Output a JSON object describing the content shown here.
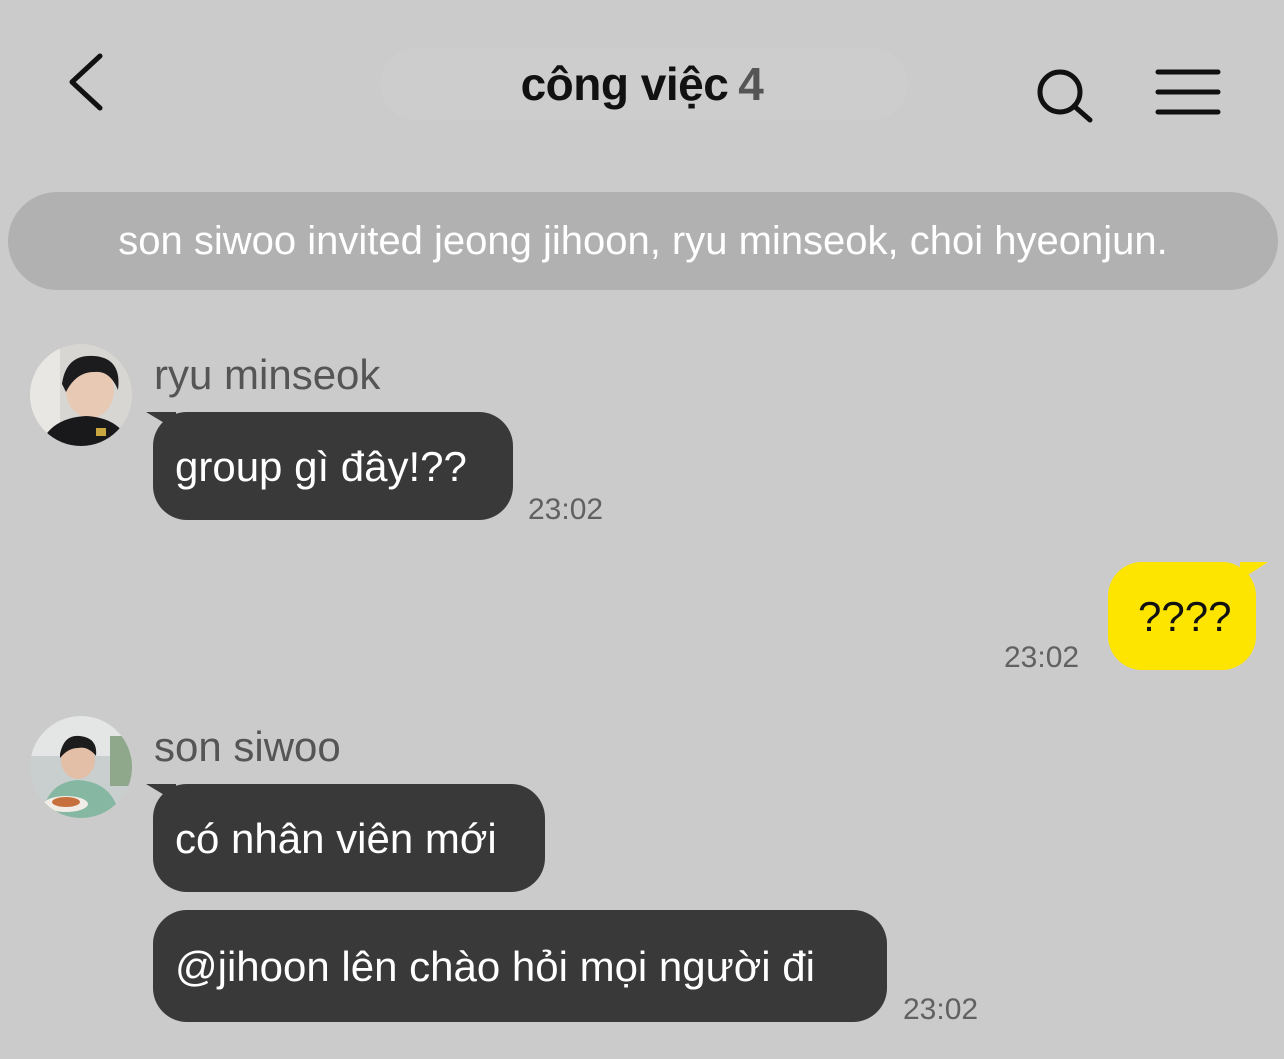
{
  "header": {
    "title": "công việc",
    "member_count": "4",
    "back_icon": "chevron-left-icon",
    "search_icon": "search-icon",
    "menu_icon": "hamburger-menu-icon"
  },
  "notice": {
    "text": "son siwoo invited jeong jihoon, ryu minseok, choi hyeonjun."
  },
  "messages": [
    {
      "sender": "ryu minseok",
      "text": "group gì đây!??",
      "time": "23:02"
    },
    {
      "sender": "me",
      "text": "????",
      "time": "23:02"
    },
    {
      "sender": "son siwoo",
      "text": "có nhân viên mới",
      "time": ""
    },
    {
      "sender": "son siwoo",
      "text": "@jihoon lên chào hỏi mọi người đi",
      "time": "23:02"
    }
  ],
  "colors": {
    "background": "#cbcbcb",
    "bubble_incoming": "#393939",
    "bubble_outgoing": "#fee500",
    "notice_bg": "#b1b1b1"
  }
}
